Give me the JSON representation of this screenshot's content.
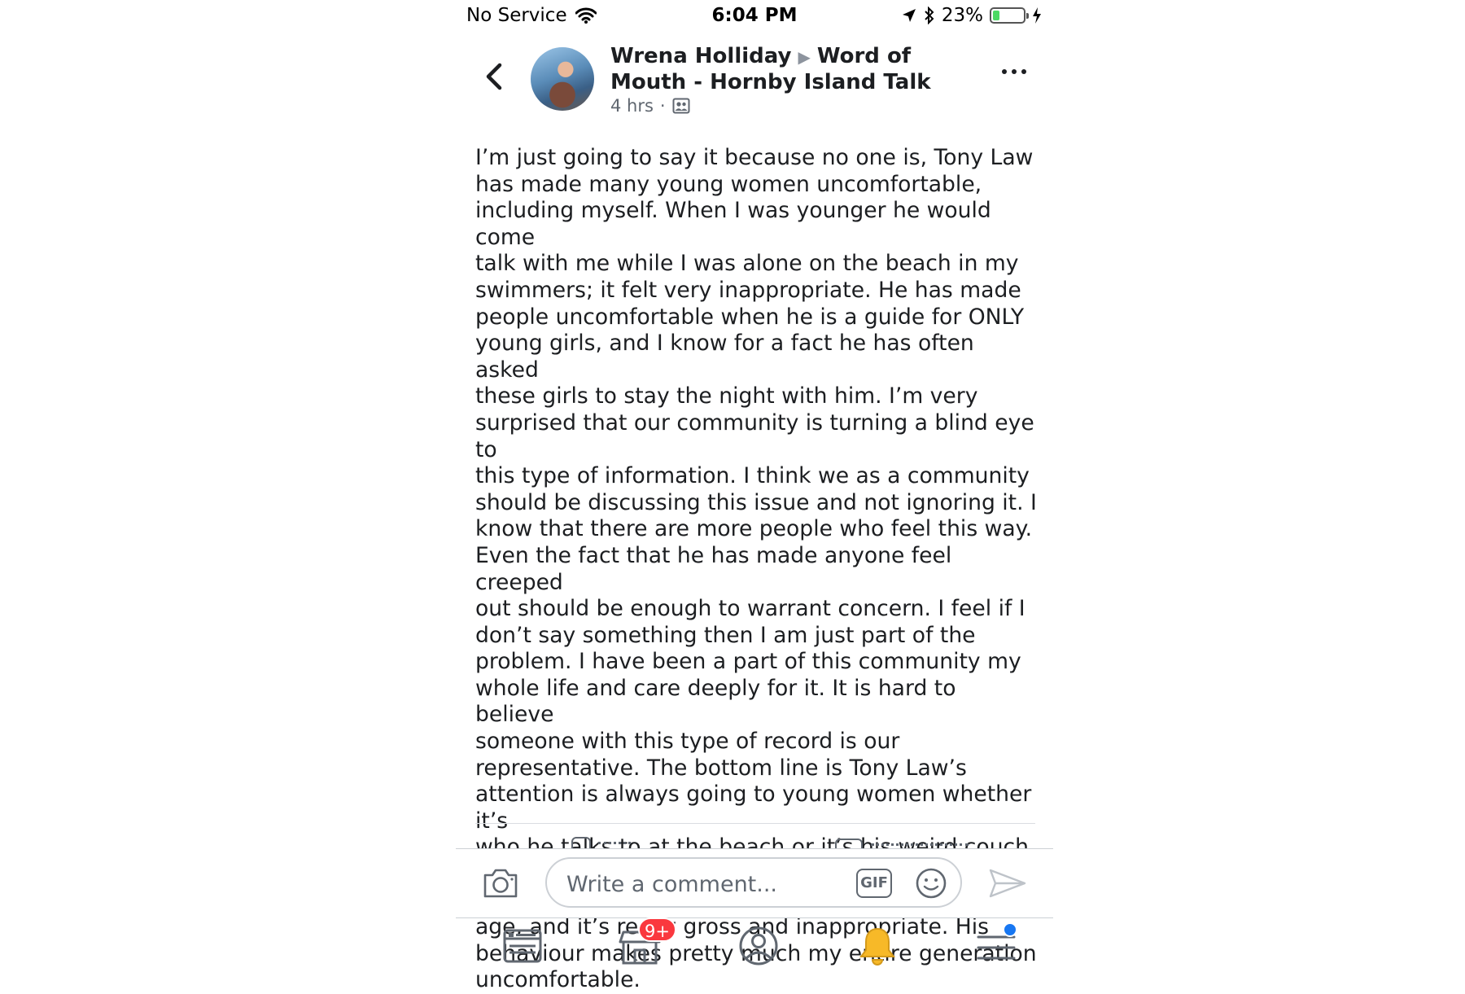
{
  "status_bar": {
    "carrier": "No Service",
    "time": "6:04 PM",
    "battery_percent": "23%",
    "battery_level": 0.23,
    "battery_color": "#4cd964"
  },
  "post": {
    "author": "Wrena Holliday",
    "group": "Word of Mouth - Hornby Island Talk",
    "time_ago": "4 hrs",
    "separator": "·",
    "audience_icon": "group-audience-icon",
    "body": "I’m just going to say it because no one is, Tony Law\nhas made many young women  uncomfortable,\nincluding myself. When I was younger he would come\ntalk with me while I was alone on the beach in my\nswimmers; it felt very inappropriate. He has made\npeople uncomfortable when he is a guide for ONLY\nyoung girls, and I know for a fact he has often asked\nthese girls to stay the night with him. I’m very\nsurprised that our community is turning a blind eye to\nthis type of information. I think we as a community\nshould be discussing this issue and not ignoring it. I\nknow that there are more people who feel this way.\nEven the fact that he has made anyone feel creeped\nout should be enough to warrant concern. I feel if I\ndon’t say something then I am just part of the\nproblem. I have been a part of this community my\nwhole life and care deeply for it. It is hard to believe\nsomeone with this type of record is our\nrepresentative. The bottom line is Tony Law’s\nattention is always going to young women whether it’s\nwho he talks to at the beach or it’s his weird couch\nsurfer thing. It’s never men, it’s never women his own\nage, and it’s really gross and inappropriate. His\nbehaviour makes pretty much my entire generation\nuncomfortable."
  },
  "composer": {
    "placeholder": "Write a comment...",
    "gif_label": "GIF"
  },
  "tabbar": {
    "marketplace_badge": "9+",
    "badge_color": "#fa383e",
    "menu_dot_color": "#1877f2",
    "notification_bell_color": "#f7b928"
  }
}
